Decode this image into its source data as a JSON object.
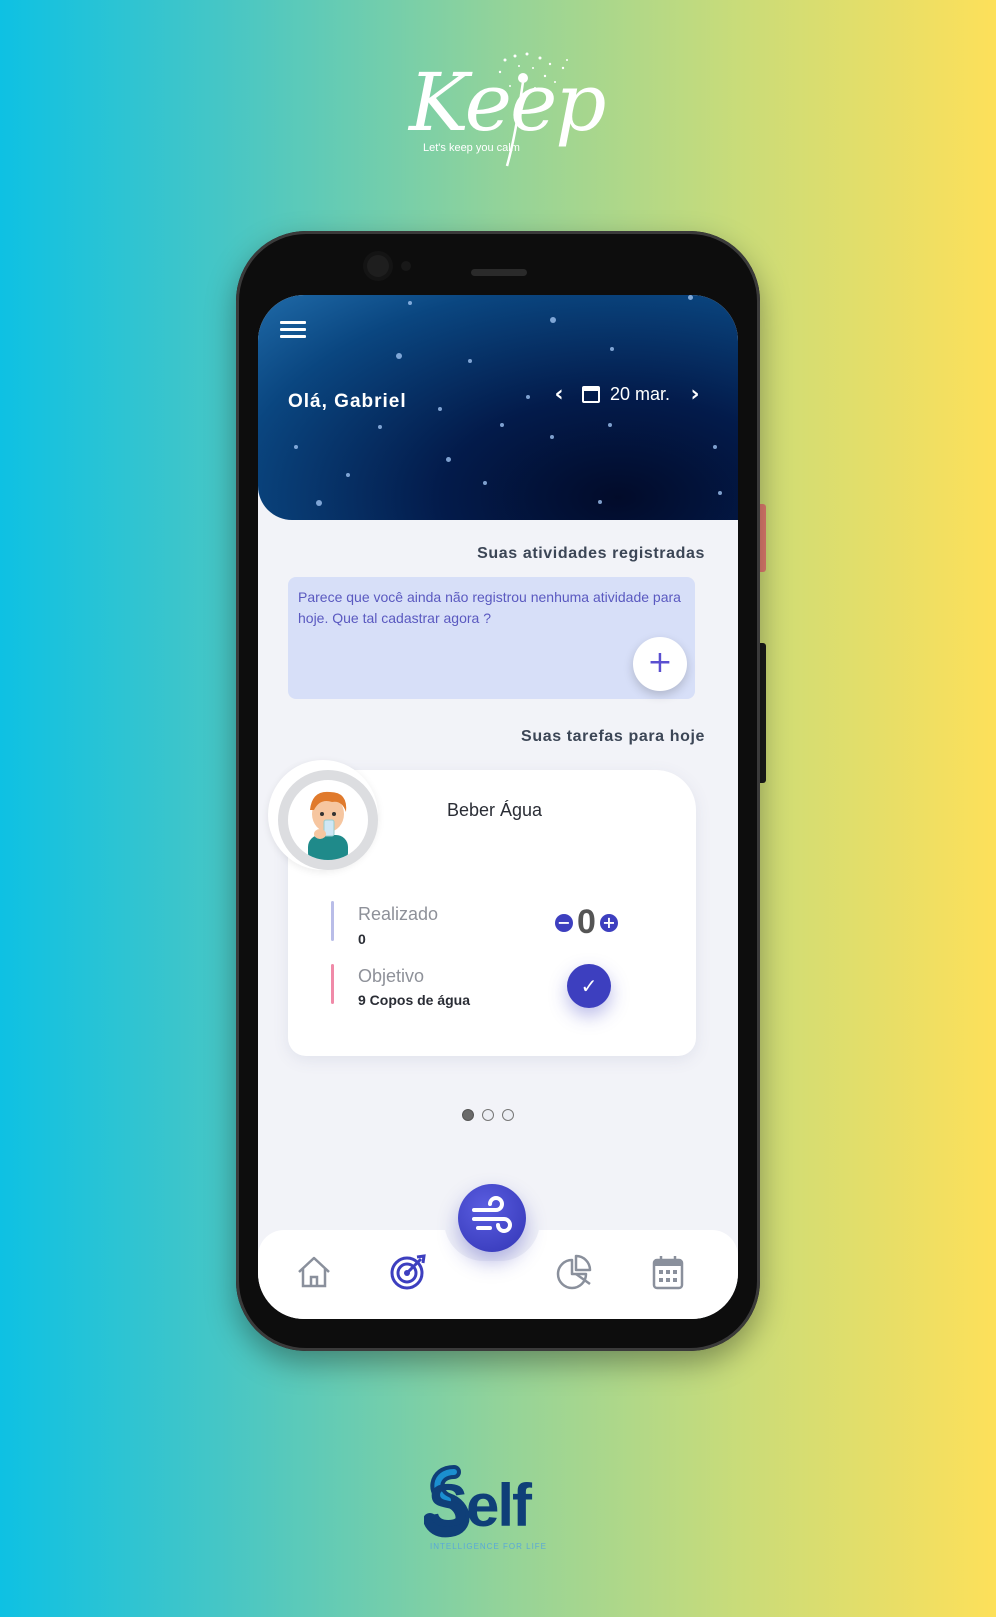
{
  "brand": {
    "keep_logo": "Keep",
    "keep_tagline": "Let's keep you calm",
    "self_logo": "Self",
    "self_tagline": "INTELLIGENCE FOR LIFE"
  },
  "header": {
    "greeting": "Olá, Gabriel",
    "date": "20 mar.",
    "menu_icon": "hamburger-menu-icon",
    "prev_icon": "chevron-left-icon",
    "next_icon": "chevron-right-icon",
    "calendar_icon": "calendar-icon"
  },
  "activities": {
    "title": "Suas atividades registradas",
    "empty_message": "Parece que você ainda não registrou nenhuma atividade para hoje. Que tal cadastrar agora ?",
    "add_label": "+"
  },
  "tasks": {
    "title": "Suas tarefas para hoje",
    "card": {
      "name": "Beber Água",
      "done_label": "Realizado",
      "done_value": "0",
      "goal_label": "Objetivo",
      "goal_value": "9 Copos de água",
      "counter": "0",
      "minus": "−",
      "plus": "+",
      "check": "✓"
    },
    "pagination": {
      "count": 3,
      "active": 0
    }
  },
  "nav": {
    "items": [
      "home-icon",
      "target-icon",
      "breathing-icon",
      "chart-pie-icon",
      "calendar-grid-icon"
    ],
    "active": "target-icon"
  },
  "colors": {
    "accent": "#3d3fbf",
    "header_dark": "#031b4b",
    "empty_box": "#d7dff8",
    "done_bar": "#b9bde8",
    "goal_bar": "#f08aa8"
  }
}
